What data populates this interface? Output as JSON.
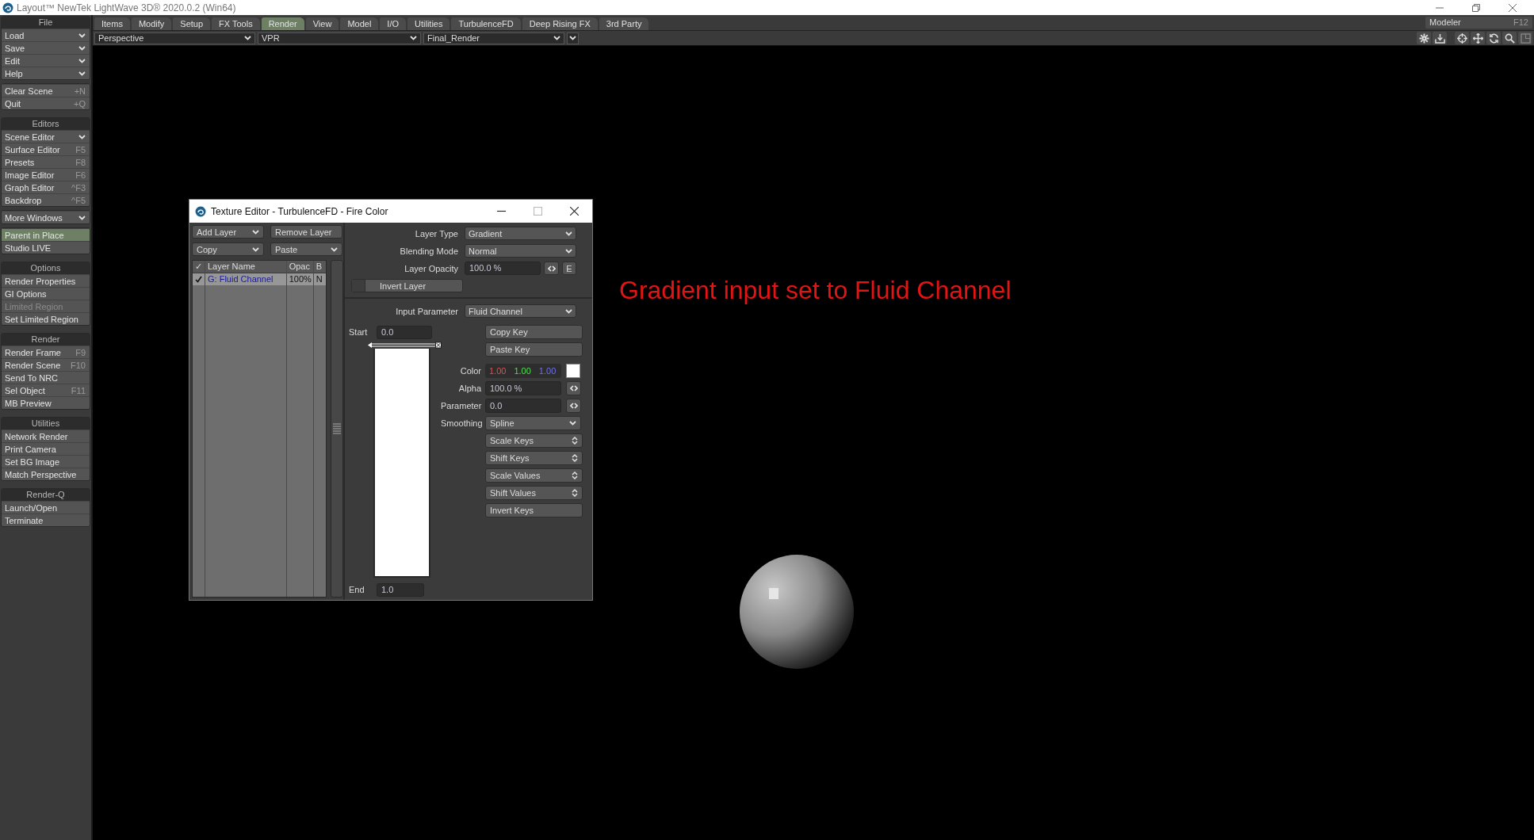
{
  "window": {
    "title": "Layout™ NewTek LightWave 3D® 2020.0.2 (Win64)"
  },
  "menu_tabs": [
    {
      "label": "Items",
      "selected": false
    },
    {
      "label": "Modify",
      "selected": false
    },
    {
      "label": "Setup",
      "selected": false
    },
    {
      "label": "FX Tools",
      "selected": false
    },
    {
      "label": "Render",
      "selected": true
    },
    {
      "label": "View",
      "selected": false
    },
    {
      "label": "Model",
      "selected": false
    },
    {
      "label": "I/O",
      "selected": false
    },
    {
      "label": "Utilities",
      "selected": false
    },
    {
      "label": "TurbulenceFD",
      "selected": false
    },
    {
      "label": "Deep Rising FX",
      "selected": false
    },
    {
      "label": "3rd Party",
      "selected": false
    }
  ],
  "mode_button": {
    "label": "Modeler",
    "shortcut": "F12"
  },
  "viewport_bar": {
    "dropdowns": [
      {
        "value": "Perspective"
      },
      {
        "value": "VPR"
      },
      {
        "value": "Final_Render"
      }
    ]
  },
  "sidebar": {
    "groups": [
      {
        "title": "File",
        "items": [
          {
            "label": "Load",
            "kind": "dropdown",
            "on": false,
            "disabled": false
          },
          {
            "label": "Save",
            "kind": "dropdown",
            "on": false,
            "disabled": false
          },
          {
            "label": "Edit",
            "kind": "dropdown",
            "on": false,
            "disabled": false
          },
          {
            "label": "Help",
            "kind": "dropdown",
            "on": false,
            "disabled": false
          }
        ]
      },
      {
        "items": [
          {
            "label": "Clear Scene",
            "kind": "command",
            "shortcut": "+N",
            "on": false,
            "disabled": false
          },
          {
            "label": "Quit",
            "kind": "command",
            "shortcut": "+Q",
            "on": false,
            "disabled": false
          }
        ]
      },
      {
        "title": "Editors",
        "items": [
          {
            "label": "Scene Editor",
            "kind": "dropdown",
            "on": false,
            "disabled": false
          },
          {
            "label": "Surface Editor",
            "kind": "command",
            "shortcut": "F5",
            "on": false,
            "disabled": false
          },
          {
            "label": "Presets",
            "kind": "command",
            "shortcut": "F8",
            "on": false,
            "disabled": false
          },
          {
            "label": "Image Editor",
            "kind": "command",
            "shortcut": "F6",
            "on": false,
            "disabled": false
          },
          {
            "label": "Graph Editor",
            "kind": "command",
            "shortcut": "^F3",
            "on": false,
            "disabled": false
          },
          {
            "label": "Backdrop",
            "kind": "command",
            "shortcut": "^F5",
            "on": false,
            "disabled": false
          }
        ]
      },
      {
        "items": [
          {
            "label": "More Windows",
            "kind": "dropdown",
            "on": false,
            "disabled": false
          }
        ]
      },
      {
        "items": [
          {
            "label": "Parent in Place",
            "kind": "command",
            "on": true,
            "disabled": false
          },
          {
            "label": "Studio LIVE",
            "kind": "command",
            "on": false,
            "disabled": false
          }
        ]
      },
      {
        "title": "Options",
        "items": [
          {
            "label": "Render Properties",
            "kind": "command",
            "on": false,
            "disabled": false
          },
          {
            "label": "GI Options",
            "kind": "command",
            "on": false,
            "disabled": false
          },
          {
            "label": "Limited Region",
            "kind": "command",
            "on": false,
            "disabled": true
          },
          {
            "label": "Set Limited Region",
            "kind": "command",
            "on": false,
            "disabled": false
          }
        ]
      },
      {
        "title": "Render",
        "items": [
          {
            "label": "Render Frame",
            "kind": "command",
            "shortcut": "F9",
            "on": false,
            "disabled": false
          },
          {
            "label": "Render Scene",
            "kind": "command",
            "shortcut": "F10",
            "on": false,
            "disabled": false
          },
          {
            "label": "Send To NRC",
            "kind": "command",
            "on": false,
            "disabled": false
          },
          {
            "label": "Sel Object",
            "kind": "command",
            "shortcut": "F11",
            "on": false,
            "disabled": false
          },
          {
            "label": "MB Preview",
            "kind": "command",
            "on": false,
            "disabled": false
          }
        ]
      },
      {
        "title": "Utilities",
        "items": [
          {
            "label": "Network Render",
            "kind": "command",
            "on": false,
            "disabled": false
          },
          {
            "label": "Print Camera",
            "kind": "command",
            "on": false,
            "disabled": false
          },
          {
            "label": "Set BG Image",
            "kind": "command",
            "on": false,
            "disabled": false
          },
          {
            "label": "Match Perspective",
            "kind": "command",
            "on": false,
            "disabled": false
          }
        ]
      },
      {
        "title": "Render-Q",
        "items": [
          {
            "label": "Launch/Open",
            "kind": "command",
            "on": false,
            "disabled": false
          },
          {
            "label": "Terminate",
            "kind": "command",
            "on": false,
            "disabled": false
          }
        ]
      }
    ]
  },
  "texture_editor": {
    "title": "Texture Editor - TurbulenceFD - Fire Color",
    "layer_buttons": [
      {
        "label": "Add Layer",
        "kind": "dropdown"
      },
      {
        "label": "Remove Layer",
        "kind": "button"
      },
      {
        "label": "Copy",
        "kind": "dropdown"
      },
      {
        "label": "Paste",
        "kind": "dropdown"
      }
    ],
    "layer_list": {
      "columns": [
        "✓",
        "Layer Name",
        "Opac",
        "B"
      ],
      "rows": [
        {
          "enabled": true,
          "name": "G: Fluid Channel",
          "opacity": "100%",
          "blend": "N",
          "selected": true
        }
      ]
    },
    "layer_settings": [
      {
        "label": "Layer Type",
        "kind": "dropdown",
        "value": "Gradient"
      },
      {
        "label": "Blending Mode",
        "kind": "dropdown",
        "value": "Normal"
      },
      {
        "label": "Layer Opacity",
        "kind": "envelope",
        "value": "100.0 %",
        "extra": "E"
      }
    ],
    "invert_layer": {
      "label": "Invert Layer",
      "checked": false
    },
    "input_parameter": {
      "label": "Input Parameter",
      "value": "Fluid Channel"
    },
    "gradient": {
      "start_label": "Start",
      "start": "0.0",
      "end_label": "End",
      "end": "1.0"
    },
    "key_controls": [
      {
        "kind": "button",
        "label": "Copy Key"
      },
      {
        "kind": "button",
        "label": "Paste Key"
      },
      {
        "kind": "color",
        "label": "Color",
        "values": [
          "1.00",
          "1.00",
          "1.00"
        ]
      },
      {
        "kind": "envelope",
        "label": "Alpha",
        "value": "100.0 %"
      },
      {
        "kind": "envelope",
        "label": "Parameter",
        "value": "0.0"
      },
      {
        "kind": "dropdown",
        "label": "Smoothing",
        "value": "Spline"
      },
      {
        "kind": "spinner",
        "label": "Scale Keys"
      },
      {
        "kind": "spinner",
        "label": "Shift Keys"
      },
      {
        "kind": "spinner",
        "label": "Scale Values"
      },
      {
        "kind": "spinner",
        "label": "Shift Values"
      },
      {
        "kind": "button",
        "label": "Invert Keys"
      }
    ]
  },
  "annotation": "Gradient input set to Fluid Channel"
}
